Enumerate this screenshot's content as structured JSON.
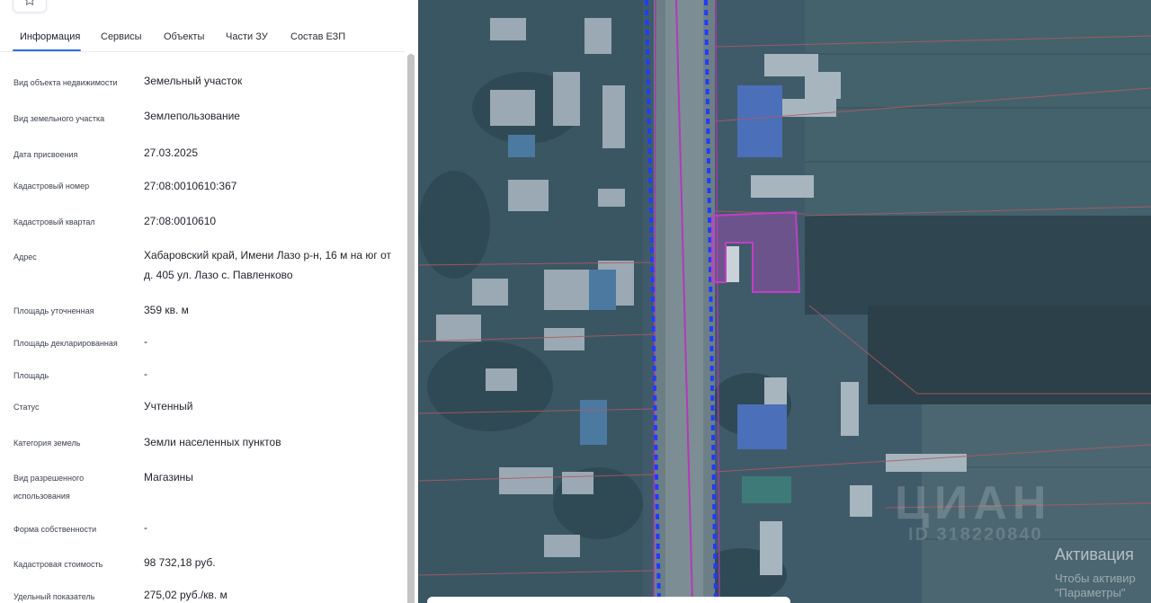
{
  "tabs": [
    {
      "label": "Информация",
      "active": true
    },
    {
      "label": "Сервисы"
    },
    {
      "label": "Объекты"
    },
    {
      "label": "Части ЗУ"
    },
    {
      "label": "Состав ЕЗП"
    }
  ],
  "fields": [
    {
      "label": "Вид объекта недвижимости",
      "value": "Земельный участок"
    },
    {
      "label": "Вид земельного участка",
      "value": "Землепользование"
    },
    {
      "label": "Дата присвоения",
      "value": "27.03.2025"
    },
    {
      "label": "Кадастровый номер",
      "value": "27:08:0010610:367"
    },
    {
      "label": "Кадастровый квартал",
      "value": "27:08:0010610"
    },
    {
      "label": "Адрес",
      "value": "Хабаровский край, Имени Лазо р-н, 16 м на юг от д. 405 ул. Лазо с. Павленково"
    },
    {
      "label": "Площадь уточненная",
      "value": "359 кв. м"
    },
    {
      "label": "Площадь декларированная",
      "value": "-"
    },
    {
      "label": "Площадь",
      "value": "-"
    },
    {
      "label": "Статус",
      "value": "Учтенный"
    },
    {
      "label": "Категория земель",
      "value": "Земли населенных пунктов"
    },
    {
      "label": "Вид разрешенного использования",
      "value": "Магазины"
    },
    {
      "label": "Форма собственности",
      "value": "-"
    },
    {
      "label": "Кадастровая стоимость",
      "value": "98 732,18 руб."
    },
    {
      "label": "Удельный показатель",
      "value": "275,02 руб./кв. м"
    }
  ],
  "map": {
    "watermark": "ЦИАН",
    "watermark_id": "ID 318220840",
    "activation_title": "Активация",
    "activation_sub_1": "Чтобы активир",
    "activation_sub_2": "\"Параметры\"",
    "parcel_color": "#c23fc4",
    "boundary_color": "#1f3cff"
  },
  "icons": {
    "top_button": "star-icon"
  }
}
